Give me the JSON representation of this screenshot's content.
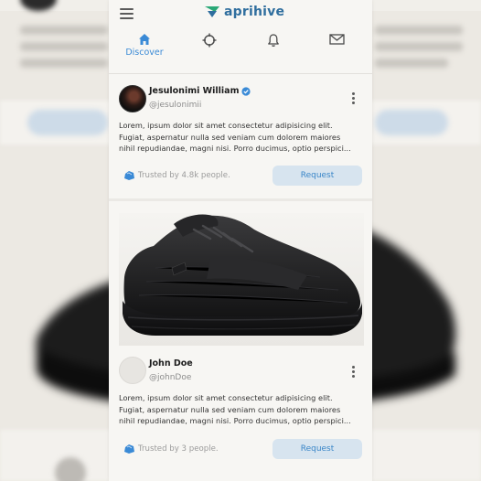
{
  "app": {
    "brand": "aprihive",
    "menu_icon": "hamburger-menu-icon",
    "brand_icon": "aprihive-logo-icon",
    "accent_color": "#3a8ad6"
  },
  "nav": {
    "items": [
      {
        "label": "Discover",
        "icon": "home-icon",
        "active": true
      },
      {
        "label": "",
        "icon": "crosshair-icon",
        "active": false
      },
      {
        "label": "",
        "icon": "bell-icon",
        "active": false
      },
      {
        "label": "",
        "icon": "mail-icon",
        "active": false
      }
    ]
  },
  "posts": [
    {
      "author": "Jesulonimi William",
      "handle": "@jesulonimii",
      "verified": true,
      "body_lines": [
        "Lorem, ipsum dolor sit amet consectetur adipisicing elit.",
        "Fugiat, aspernatur nulla sed veniam cum dolorem maiores",
        "nihil repudiandae, magni nisi. Porro ducimus, optio perspici..."
      ],
      "trust": "Trusted by 4.8k people.",
      "action": "Request"
    },
    {
      "author": "John Doe",
      "handle": "@johnDoe",
      "verified": false,
      "body_lines": [
        "Lorem, ipsum dolor sit amet consectetur adipisicing elit.",
        "Fugiat, aspernatur nulla sed veniam cum dolorem maiores",
        "nihil repudiandae, magni nisi. Porro ducimus, optio perspici..."
      ],
      "trust": "Trusted by 3 people.",
      "action": "Request"
    }
  ]
}
